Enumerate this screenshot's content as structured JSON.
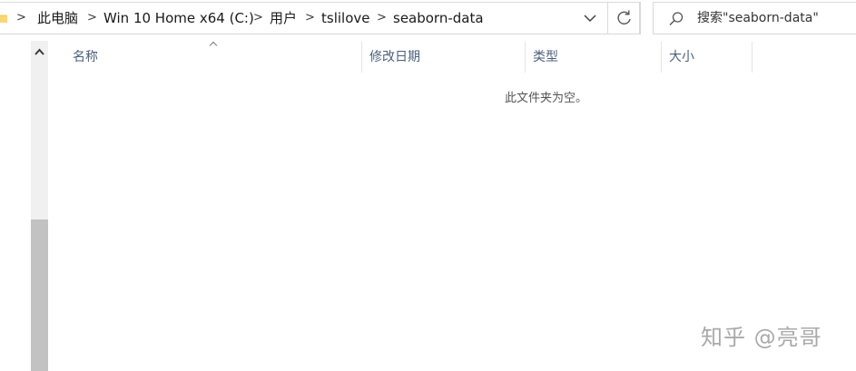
{
  "address_bar": {
    "crumbs": [
      "此电脑",
      "Win 10 Home x64 (C:)",
      "用户",
      "tslilove",
      "seaborn-data"
    ]
  },
  "search": {
    "placeholder": "搜索\"seaborn-data\""
  },
  "columns": {
    "name": "名称",
    "modified": "修改日期",
    "type": "类型",
    "size": "大小"
  },
  "empty_message": "此文件夹为空。",
  "watermark": "知乎 @亮哥",
  "colors": {
    "header_text": "#4c607a",
    "border": "#d9d9d9",
    "scroll_thumb": "#c2c2c2"
  }
}
